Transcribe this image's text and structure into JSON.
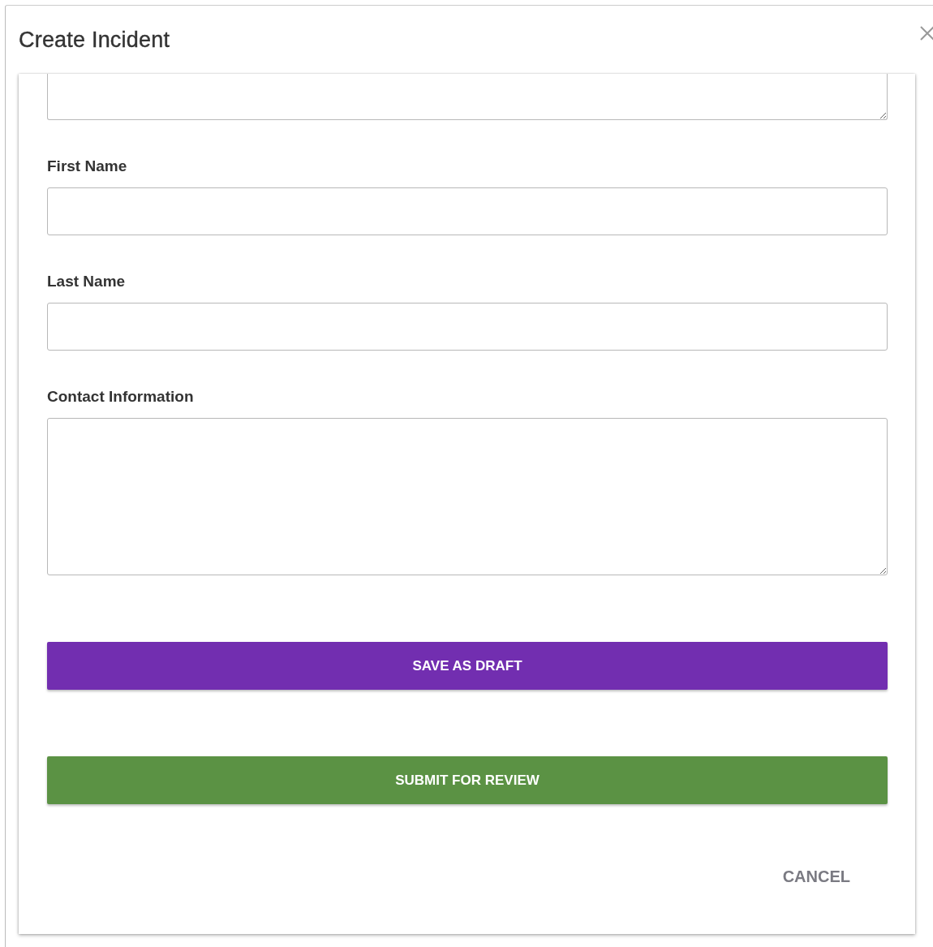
{
  "dialog": {
    "title": "Create Incident"
  },
  "fields": [
    {
      "kind": "partial"
    },
    {
      "kind": "input",
      "label": "First Name"
    },
    {
      "kind": "input",
      "label": "Last Name"
    },
    {
      "kind": "textarea",
      "label": "Contact Information"
    }
  ],
  "buttons": [
    {
      "kind": "primary",
      "label": "SAVE AS DRAFT"
    },
    {
      "kind": "success",
      "label": "SUBMIT FOR REVIEW"
    },
    {
      "kind": "text",
      "label": "CANCEL"
    }
  ]
}
